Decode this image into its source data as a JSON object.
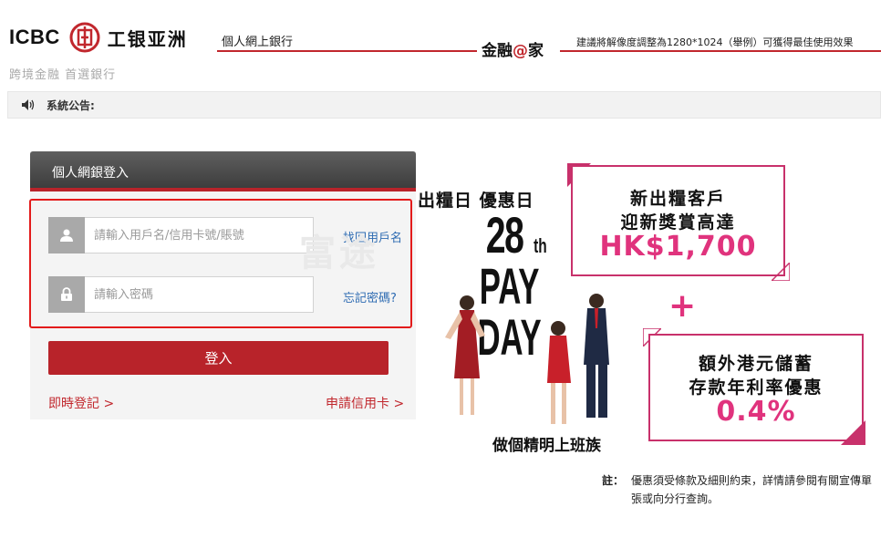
{
  "header": {
    "brand_en": "ICBC",
    "brand_cn": "工银亚洲",
    "tagline": "跨境金融 首選銀行",
    "subtitle": "個人網上銀行",
    "jinrong_prefix": "金融",
    "jinrong_at": "@",
    "jinrong_suffix": "家",
    "resolution_note": "建議將解像度調整為1280*1024（舉例）可獲得最佳使用效果"
  },
  "announcement": {
    "label": "系統公告:"
  },
  "login": {
    "title": "個人網銀登入",
    "username_placeholder": "請輸入用戶名/信用卡號/賬號",
    "password_placeholder": "請輸入密碼",
    "forgot_username": "找回用戶名",
    "forgot_password": "忘記密碼?",
    "submit": "登入",
    "register": "即時登記 >",
    "apply_card": "申請信用卡 >"
  },
  "promo": {
    "headline": "出糧日  優惠日",
    "big_number": "28",
    "big_suffix": "th",
    "pay": "PAY",
    "day": "DAY",
    "caption": "做個精明上班族",
    "watermark": "富途",
    "box1_line1": "新出糧客戶",
    "box1_line2": "迎新獎賞高達",
    "box1_amount": "HK$1,700",
    "plus": "+",
    "box2_line1": "額外港元儲蓄",
    "box2_line2": "存款年利率優惠",
    "box2_amount": "0.4%",
    "note_label": "註：",
    "note_text": "優惠須受條款及細則約束，詳情請參閱有關宣傳單張或向分行查詢。"
  },
  "colors": {
    "brand_red": "#c1272d",
    "promo_pink": "#e0337d",
    "link_blue": "#2e6bb2"
  }
}
